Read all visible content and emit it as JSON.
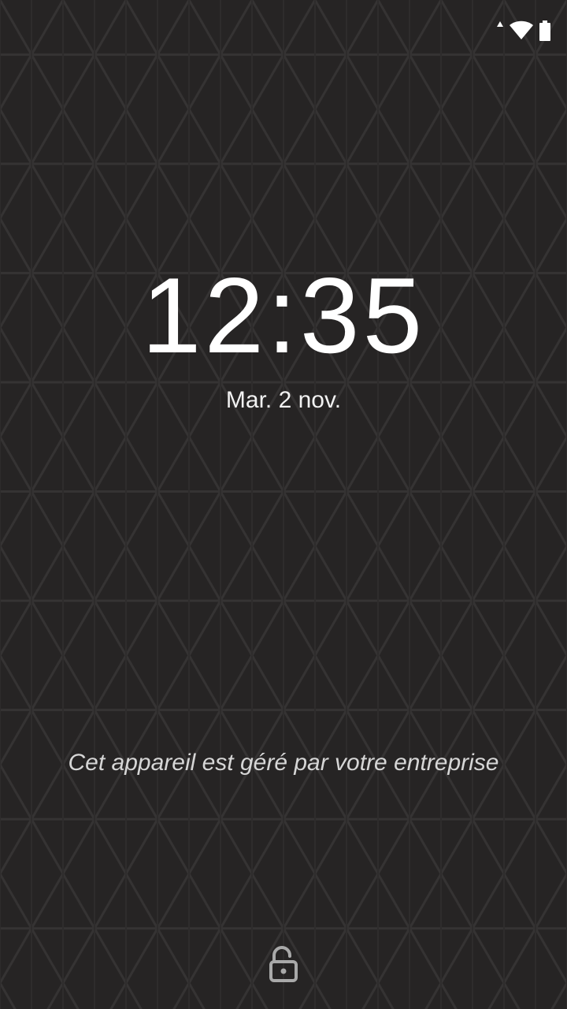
{
  "status_bar": {
    "icons": [
      "data-activity-icon",
      "wifi-icon",
      "battery-icon"
    ]
  },
  "lockscreen": {
    "time": "12:35",
    "date": "Mar. 2 nov.",
    "owner_info": "Cet appareil est géré par votre entreprise"
  },
  "colors": {
    "background": "#262424",
    "pattern_line": "#373535",
    "text_primary": "#ffffff",
    "text_secondary": "#d6d6d6",
    "lock_icon": "#a9a9a9"
  },
  "lock_icon": "lock-open-icon"
}
